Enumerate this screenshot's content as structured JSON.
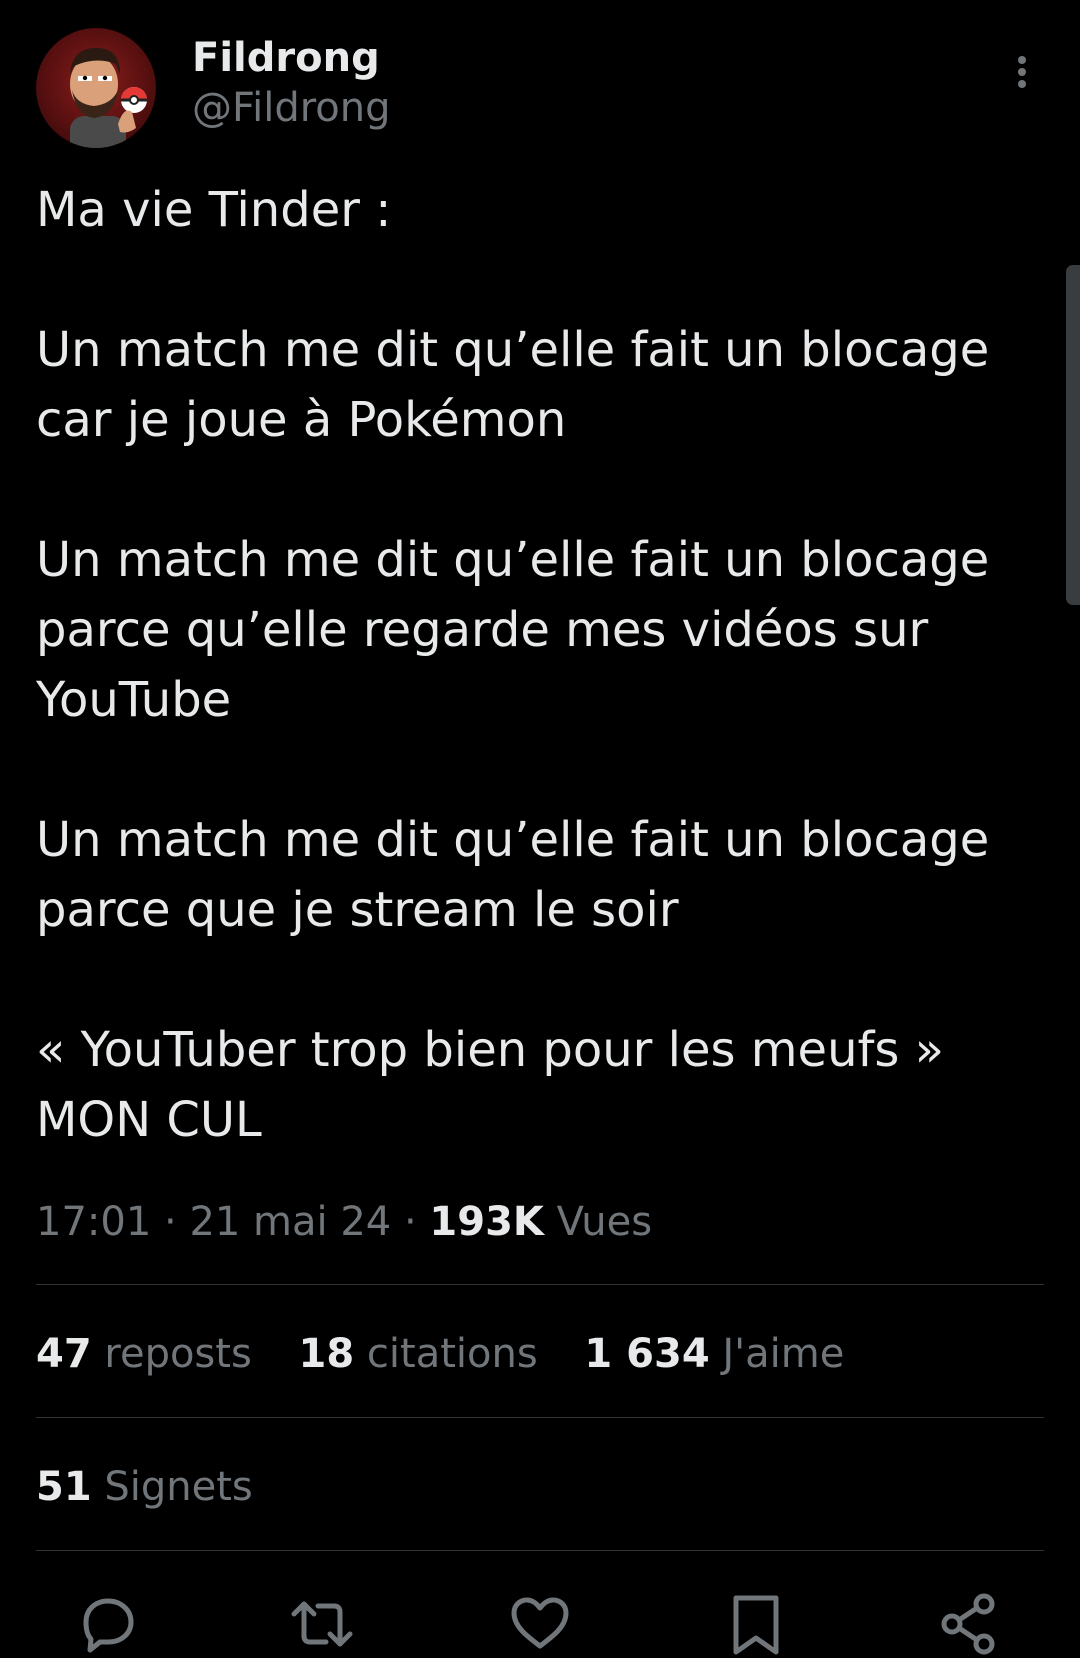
{
  "author": {
    "display_name": "Fildrong",
    "handle": "@Fildrong"
  },
  "tweet": {
    "paragraphs": [
      "Ma vie Tinder :",
      "Un match me dit qu’elle fait un blocage\ncar je joue à Pokémon",
      "Un match me dit qu’elle fait un blocage\nparce qu’elle regarde mes vidéos sur\nYouTube",
      "Un match me dit qu’elle fait un blocage\nparce que je stream le soir",
      "« YouTuber trop bien pour les meufs »\nMON CUL"
    ]
  },
  "meta": {
    "time": "17:01",
    "separator": " · ",
    "date": "21 mai 24",
    "views_count": "193K",
    "views_label": "Vues"
  },
  "stats": {
    "reposts_count": "47",
    "reposts_label": "reposts",
    "quotes_count": "18",
    "quotes_label": "citations",
    "likes_count": "1 634",
    "likes_label": "J'aime",
    "bookmarks_count": "51",
    "bookmarks_label": "Signets"
  },
  "actions": {
    "icons": [
      "reply-icon",
      "repost-icon",
      "like-icon",
      "bookmark-icon",
      "share-icon"
    ]
  },
  "colors": {
    "background": "#000000",
    "primary_text": "#e7e9ea",
    "secondary_text": "#71767b",
    "divider": "#2f3336"
  }
}
